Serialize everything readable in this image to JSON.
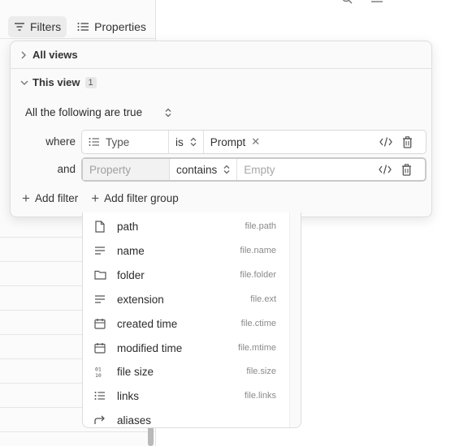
{
  "toolbar": {
    "filters_label": "Filters",
    "properties_label": "Properties"
  },
  "popover": {
    "all_views_label": "All views",
    "this_view_label": "This view",
    "this_view_count": "1",
    "conjunction": "All the following are true",
    "filters": [
      {
        "label": "where",
        "property": "Type",
        "operator": "is",
        "value": "Prompt",
        "value_placeholder": ""
      },
      {
        "label": "and",
        "property": "",
        "property_placeholder": "Property",
        "operator": "contains",
        "value": "",
        "value_placeholder": "Empty"
      }
    ],
    "add_filter_label": "Add filter",
    "add_filter_group_label": "Add filter group"
  },
  "dropdown": {
    "items": [
      {
        "label": "path",
        "key": "file.path",
        "icon": "file-icon"
      },
      {
        "label": "name",
        "key": "file.name",
        "icon": "text-lines-icon"
      },
      {
        "label": "folder",
        "key": "file.folder",
        "icon": "folder-icon"
      },
      {
        "label": "extension",
        "key": "file.ext",
        "icon": "text-lines-icon"
      },
      {
        "label": "created time",
        "key": "file.ctime",
        "icon": "calendar-icon"
      },
      {
        "label": "modified time",
        "key": "file.mtime",
        "icon": "calendar-icon"
      },
      {
        "label": "file size",
        "key": "file.size",
        "icon": "binary-icon"
      },
      {
        "label": "links",
        "key": "file.links",
        "icon": "list-icon"
      },
      {
        "label": "aliases",
        "key": "",
        "icon": "forward-arrow-icon"
      }
    ]
  }
}
